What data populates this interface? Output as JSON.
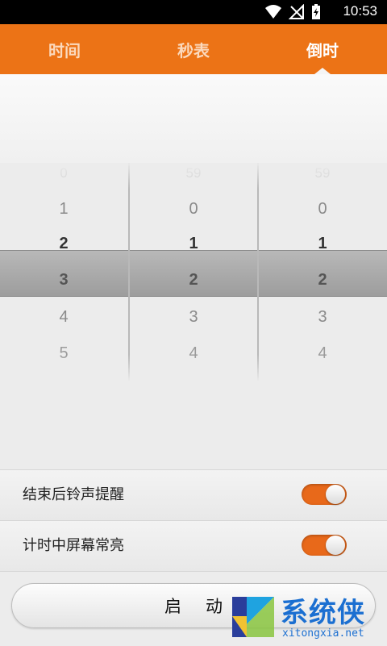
{
  "status_bar": {
    "time": "10:53"
  },
  "tabs": [
    {
      "label": "时间",
      "active": false
    },
    {
      "label": "秒表",
      "active": false
    },
    {
      "label": "倒时",
      "active": true
    }
  ],
  "picker": {
    "columns": [
      {
        "values": [
          "0",
          "1",
          "2",
          "3",
          "4",
          "5"
        ],
        "selected": "3"
      },
      {
        "values": [
          "59",
          "0",
          "1",
          "2",
          "3",
          "4"
        ],
        "selected": "2"
      },
      {
        "values": [
          "59",
          "0",
          "1",
          "2",
          "3",
          "4"
        ],
        "selected": "2"
      }
    ]
  },
  "settings": [
    {
      "label": "结束后铃声提醒",
      "enabled": true
    },
    {
      "label": "计时中屏幕常亮",
      "enabled": true
    }
  ],
  "start_button": {
    "label": "启动"
  },
  "watermark": {
    "text": "系统侠",
    "url": "xitongxia.net"
  },
  "colors": {
    "accent": "#ec7316",
    "toggle_on": "#e8691a"
  }
}
